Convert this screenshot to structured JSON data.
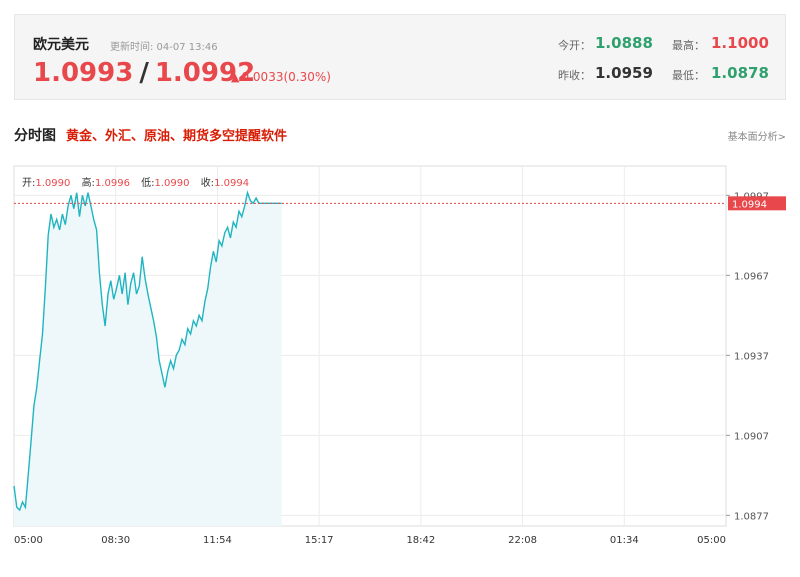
{
  "header": {
    "pair_name": "欧元美元",
    "update_label": "更新时间: 04-07 13:46",
    "bid": "1.0993",
    "separator": "/",
    "ask": "1.0992",
    "change": "0.0033(0.30%)",
    "stats": {
      "open_label": "今开：",
      "open": "1.0888",
      "high_label": "最高：",
      "high": "1.1000",
      "prev_close_label": "昨收：",
      "prev_close": "1.0959",
      "low_label": "最低：",
      "low": "1.0878"
    }
  },
  "section": {
    "title": "分时图",
    "promo_link": "黄金、外汇、原油、期货多空提醒软件",
    "fundamental_link": "基本面分析>"
  },
  "ohlc": {
    "open_label": "开:",
    "open": "1.0990",
    "high_label": "高:",
    "high": "1.0996",
    "low_label": "低:",
    "low": "1.0990",
    "close_label": "收:",
    "close": "1.0994"
  },
  "colors": {
    "line": "#1fb5c0",
    "fill": "#eef8fb",
    "accent": "#e8484b",
    "positive": "#2fa06e"
  },
  "chart_data": {
    "type": "area",
    "x_ticks": [
      "05:00",
      "08:30",
      "11:54",
      "15:17",
      "18:42",
      "22:08",
      "01:34",
      "05:00"
    ],
    "y_ticks": [
      1.0877,
      1.0907,
      1.0937,
      1.0967,
      1.0997
    ],
    "ylim": [
      1.0873,
      1.1008
    ],
    "current_price": "1.0994",
    "x_fraction_range": [
      0,
      1
    ],
    "series": [
      {
        "x": [
          0,
          0.004,
          0.008,
          0.012,
          0.016,
          0.02,
          0.024,
          0.028,
          0.032,
          0.036,
          0.04,
          0.044,
          0.048,
          0.052,
          0.056,
          0.06,
          0.064,
          0.068,
          0.072,
          0.076,
          0.08,
          0.084,
          0.088,
          0.092,
          0.096,
          0.1,
          0.104,
          0.108,
          0.112,
          0.116,
          0.12,
          0.124,
          0.128,
          0.132,
          0.136,
          0.14,
          0.144,
          0.148,
          0.152,
          0.156,
          0.16,
          0.164,
          0.168,
          0.172,
          0.176,
          0.18,
          0.184,
          0.188,
          0.192,
          0.196,
          0.2,
          0.204,
          0.208,
          0.212,
          0.216,
          0.22,
          0.224,
          0.228,
          0.232,
          0.236,
          0.24,
          0.244,
          0.248,
          0.252,
          0.256,
          0.26,
          0.264,
          0.268,
          0.272,
          0.276,
          0.28,
          0.284,
          0.288,
          0.292,
          0.296,
          0.3,
          0.304,
          0.308,
          0.312,
          0.316,
          0.32,
          0.324,
          0.328,
          0.332,
          0.336,
          0.34,
          0.344,
          0.348,
          0.352,
          0.356,
          0.36,
          0.364,
          0.368,
          0.372,
          0.376
        ],
        "values": [
          1.0888,
          1.088,
          1.0879,
          1.0882,
          1.088,
          1.0892,
          1.0905,
          1.0918,
          1.0925,
          1.0935,
          1.0945,
          1.0962,
          1.0982,
          1.099,
          1.0985,
          1.0988,
          1.0984,
          1.099,
          1.0986,
          1.0993,
          1.0997,
          1.0992,
          1.0998,
          1.0989,
          1.0997,
          1.0993,
          1.0998,
          1.0993,
          1.0988,
          1.0984,
          1.0968,
          1.0956,
          1.0948,
          1.096,
          1.0965,
          1.0958,
          1.0962,
          1.0967,
          1.096,
          1.0968,
          1.0956,
          1.0964,
          1.0968,
          1.096,
          1.0963,
          1.0974,
          1.0966,
          1.096,
          1.0955,
          1.095,
          1.0944,
          1.0935,
          1.093,
          1.0925,
          1.0931,
          1.0935,
          1.0932,
          1.0937,
          1.0939,
          1.0943,
          1.0941,
          1.0947,
          1.0945,
          1.095,
          1.0948,
          1.0952,
          1.095,
          1.0957,
          1.0962,
          1.097,
          1.0976,
          1.0972,
          1.098,
          1.0978,
          1.0983,
          1.0985,
          1.0981,
          1.0987,
          1.0985,
          1.0991,
          1.0989,
          1.0993,
          1.0998,
          1.0995,
          1.0994,
          1.0996,
          1.0994,
          1.0994,
          1.0994,
          1.0994,
          1.0994,
          1.0994,
          1.0994,
          1.0994,
          1.0994
        ]
      }
    ]
  }
}
